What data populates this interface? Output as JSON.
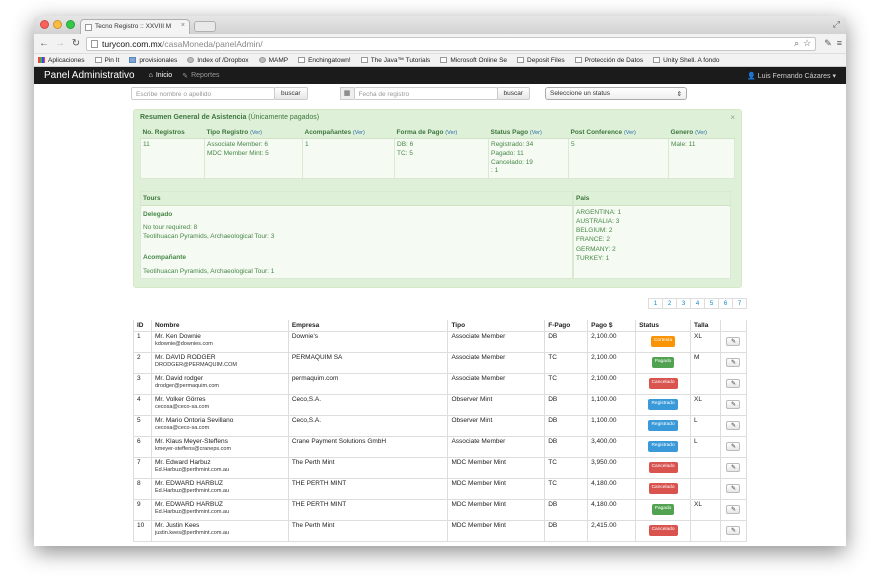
{
  "browser": {
    "tab_title": "Tecno Registro :: XXVIII M",
    "url_host": "turycon.com.mx",
    "url_path": "/casaMoneda/panelAdmin/"
  },
  "bookmarks": [
    "Aplicaciones",
    "Pin It",
    "provisionales",
    "Index of /Dropbox",
    "MAMP",
    "Enchingatown!",
    "The Java™ Tutorials",
    "Microsoft Online Se",
    "Deposit Files",
    "Protección de Datos",
    "Unity Shell. A fondo"
  ],
  "navbar": {
    "brand": "Panel Administrativo",
    "home": "Inicio",
    "reports": "Reportes",
    "user": "Luis Fernando Cázares"
  },
  "filters": {
    "name_placeholder": "Escribe nombre o apellido",
    "search1": "buscar",
    "date_placeholder": "Fecha de registro",
    "search2": "buscar",
    "status_select": "Seleccione un status"
  },
  "summary": {
    "title": "Resumen General de Asistencia",
    "title_note": "(Únicamente pagados)",
    "ver": "(Ver)",
    "headers": [
      "No. Registros",
      "Tipo Registro",
      "Acompañantes",
      "Forma de Pago",
      "Status Pago",
      "Post Conference",
      "Genero"
    ],
    "has_ver": [
      false,
      true,
      true,
      true,
      true,
      true,
      true
    ],
    "cells": [
      [
        "11"
      ],
      [
        "Associate Member: 6",
        "MDC Member Mint: 5"
      ],
      [
        "1"
      ],
      [
        "DB: 6",
        "TC: 5"
      ],
      [
        "Registrado: 34",
        "Pagado: 11",
        "Cancelado: 19",
        ": 1"
      ],
      [
        "5"
      ],
      [
        "Male: 11"
      ]
    ],
    "tours_title": "Tours",
    "delegado_label": "Delegado",
    "delegado_items": [
      "No tour required: 8",
      "Teotihuacan Pyramids, Archaeological Tour: 3"
    ],
    "acompanante_label": "Acompañante",
    "acompanante_items": [
      "Teotihuacan Pyramids, Archaeological Tour: 1"
    ],
    "pais_title": "Pais",
    "pais_items": [
      "ARGENTINA: 1",
      "AUSTRALIA: 3",
      "BELGIUM: 2",
      "FRANCE: 2",
      "GERMANY: 2",
      "TURKEY: 1"
    ]
  },
  "pagination": [
    "1",
    "2",
    "3",
    "4",
    "5",
    "6",
    "7"
  ],
  "table": {
    "headers": [
      "ID",
      "Nombre",
      "Empresa",
      "Tipo",
      "F-Pago",
      "Pago $",
      "Status",
      "Talla",
      ""
    ],
    "rows": [
      {
        "id": "1",
        "name": "Mr. Ken Downie",
        "email": "kdownie@downies.com",
        "company": "Downie's",
        "type": "Associate Member",
        "pay": "DB",
        "amount": "2,100.00",
        "status": "Cortesía",
        "color": "#f89406",
        "size": "XL"
      },
      {
        "id": "2",
        "name": "Mr. DAVID RODGER",
        "email": "DRODGER@PERMAQUIM.COM",
        "company": "PERMAQUIM SA",
        "type": "Associate Member",
        "pay": "TC",
        "amount": "2,100.00",
        "status": "Pagado",
        "color": "#51a351",
        "size": "M"
      },
      {
        "id": "3",
        "name": "Mr. David rodger",
        "email": "drodger@permaquim.com",
        "company": "permaquim.com",
        "type": "Associate Member",
        "pay": "TC",
        "amount": "2,100.00",
        "status": "Cancelado",
        "color": "#d9534f",
        "size": ""
      },
      {
        "id": "4",
        "name": "Mr. Volker Görres",
        "email": "cecosa@ceco-sa.com",
        "company": "Ceco,S.A.",
        "type": "Observer Mint",
        "pay": "DB",
        "amount": "1,100.00",
        "status": "Registrado",
        "color": "#3a9ad9",
        "size": "XL"
      },
      {
        "id": "5",
        "name": "Mr. Mario Ontoria Sevillano",
        "email": "cecosa@ceco-sa.com",
        "company": "Ceco,S.A.",
        "type": "Observer Mint",
        "pay": "DB",
        "amount": "1,100.00",
        "status": "Registrado",
        "color": "#3a9ad9",
        "size": "L"
      },
      {
        "id": "6",
        "name": "Mr. Klaus Meyer-Steffens",
        "email": "kmeyer-steffens@craneps.com",
        "company": "Crane Payment Solutions GmbH",
        "type": "Associate Member",
        "pay": "DB",
        "amount": "3,400.00",
        "status": "Registrado",
        "color": "#3a9ad9",
        "size": "L"
      },
      {
        "id": "7",
        "name": "Mr. Edward Harbuz",
        "email": "Ed.Harbuz@perthmint.com.au",
        "company": "The Perth Mint",
        "type": "MDC Member Mint",
        "pay": "TC",
        "amount": "3,950.00",
        "status": "Cancelado",
        "color": "#d9534f",
        "size": ""
      },
      {
        "id": "8",
        "name": "Mr. EDWARD HARBUZ",
        "email": "Ed.Harbuz@perthmint.com.au",
        "company": "THE PERTH MINT",
        "type": "MDC Member Mint",
        "pay": "TC",
        "amount": "4,180.00",
        "status": "Cancelado",
        "color": "#d9534f",
        "size": ""
      },
      {
        "id": "9",
        "name": "Mr. EDWARD HARBUZ",
        "email": "Ed.Harbuz@perthmint.com.au",
        "company": "THE PERTH MINT",
        "type": "MDC Member Mint",
        "pay": "DB",
        "amount": "4,180.00",
        "status": "Pagado",
        "color": "#51a351",
        "size": "XL"
      },
      {
        "id": "10",
        "name": "Mr. Justin Kees",
        "email": "justin.kees@perthmint.com.au",
        "company": "The Perth Mint",
        "type": "MDC Member Mint",
        "pay": "DB",
        "amount": "2,415.00",
        "status": "Cancelado",
        "color": "#d9534f",
        "size": ""
      }
    ]
  }
}
